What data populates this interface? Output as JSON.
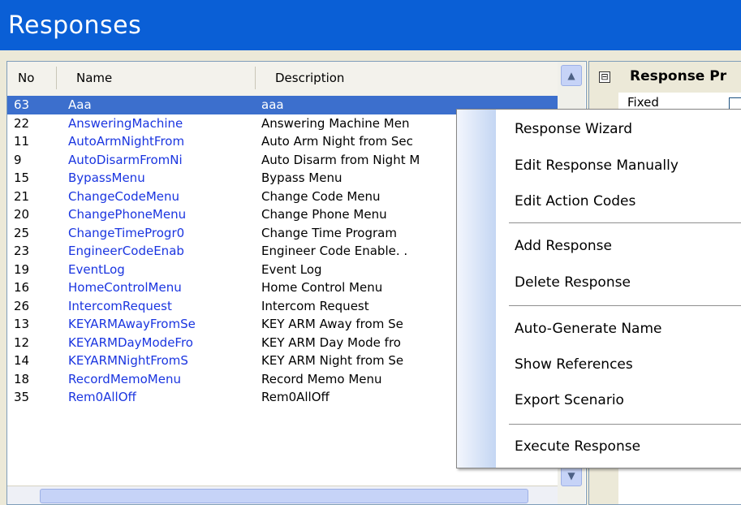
{
  "window": {
    "title": "Responses"
  },
  "grid": {
    "columns": {
      "no": "No",
      "name": "Name",
      "description": "Description"
    },
    "rows": [
      {
        "no": "63",
        "name": "Aaa",
        "description": "aaa",
        "selected": true
      },
      {
        "no": "22",
        "name": "AnsweringMachine",
        "description": "Answering Machine Men"
      },
      {
        "no": "11",
        "name": "AutoArmNightFrom",
        "description": "Auto Arm Night from Sec"
      },
      {
        "no": "9",
        "name": "AutoDisarmFromNi",
        "description": "Auto Disarm from Night M"
      },
      {
        "no": "15",
        "name": "BypassMenu",
        "description": "Bypass Menu"
      },
      {
        "no": "21",
        "name": "ChangeCodeMenu",
        "description": "Change Code Menu"
      },
      {
        "no": "20",
        "name": "ChangePhoneMenu",
        "description": "Change Phone Menu"
      },
      {
        "no": "25",
        "name": "ChangeTimeProgr0",
        "description": "Change Time Program"
      },
      {
        "no": "23",
        "name": "EngineerCodeEnab",
        "description": "Engineer Code Enable. ."
      },
      {
        "no": "19",
        "name": "EventLog",
        "description": "Event Log"
      },
      {
        "no": "16",
        "name": "HomeControlMenu",
        "description": "Home Control Menu"
      },
      {
        "no": "26",
        "name": "IntercomRequest",
        "description": "Intercom Request"
      },
      {
        "no": "13",
        "name": "KEYARMAwayFromSe",
        "description": "KEY ARM Away from Se"
      },
      {
        "no": "12",
        "name": "KEYARMDayModeFro",
        "description": "KEY ARM Day Mode fro"
      },
      {
        "no": "14",
        "name": "KEYARMNightFromS",
        "description": "KEY ARM Night from Se"
      },
      {
        "no": "18",
        "name": "RecordMemoMenu",
        "description": "Record Memo Menu"
      },
      {
        "no": "35",
        "name": "Rem0AllOff",
        "description": "Rem0AllOff"
      }
    ],
    "scroll": {
      "up_glyph": "▲",
      "down_glyph": "▼"
    }
  },
  "properties": {
    "expander": "⊟",
    "title": "Response Pr",
    "fields": [
      {
        "label": "Fixed",
        "checked": false
      }
    ]
  },
  "context_menu": {
    "items": [
      {
        "label": "Response Wizard"
      },
      {
        "label": "Edit Response Manually"
      },
      {
        "label": "Edit Action Codes"
      },
      {
        "label": "Add Response"
      },
      {
        "label": "Delete Response"
      },
      {
        "label": "Auto-Generate Name"
      },
      {
        "label": "Show References"
      },
      {
        "label": "Export Scenario"
      },
      {
        "label": "Execute Response"
      }
    ]
  },
  "colors": {
    "title_bar": "#0a5fd6",
    "selection": "#3c6fcd",
    "name_link": "#1a35e0",
    "menu_gutter": "#c4d6f3"
  }
}
